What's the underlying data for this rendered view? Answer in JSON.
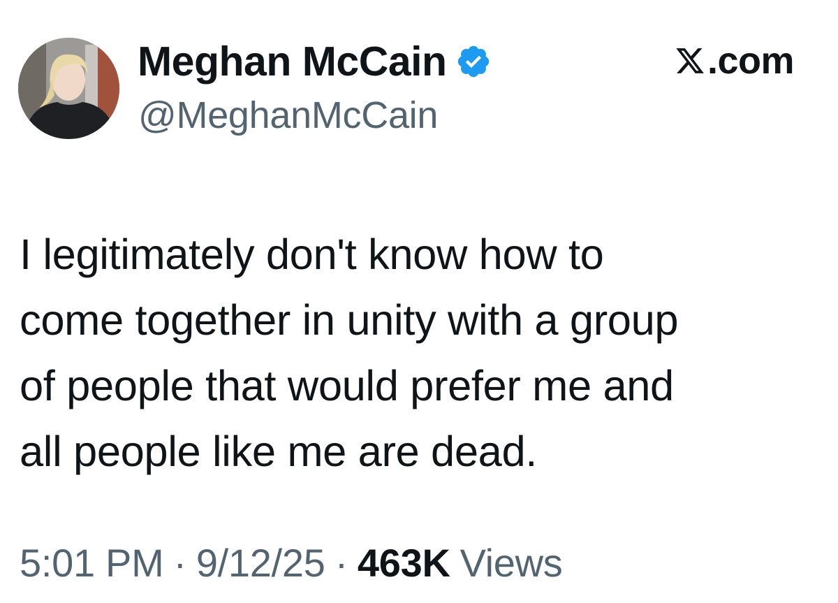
{
  "author": {
    "display_name": "Meghan McCain",
    "handle": "@MeghanMcCain",
    "verified_icon": "verified-badge-icon",
    "avatar_icon": "profile-photo"
  },
  "brand": {
    "logo_icon": "x-logo-icon",
    "text": ".com"
  },
  "tweet": {
    "lines": [
      "I legitimately don't know how to",
      "come together in unity with a group",
      "of people that would prefer me and",
      "all people like me are dead."
    ]
  },
  "meta": {
    "time": "5:01 PM",
    "separator": "·",
    "date": "9/12/25",
    "views_count": "463K",
    "views_label": "Views"
  },
  "colors": {
    "text_primary": "#0f1419",
    "text_secondary": "#536471",
    "verified_blue": "#1d9bf0",
    "background": "#ffffff"
  }
}
